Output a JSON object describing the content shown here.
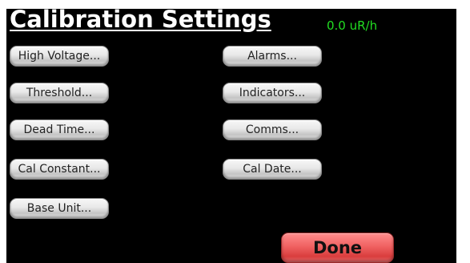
{
  "title": "Calibration Settings",
  "reading": "0.0 uR/h",
  "colors": {
    "background": "#000000",
    "reading": "#22dd22",
    "done": "#e85050"
  },
  "left_buttons": [
    {
      "label": "High Voltage..."
    },
    {
      "label": "Threshold..."
    },
    {
      "label": "Dead Time..."
    },
    {
      "label": "Cal Constant..."
    },
    {
      "label": "Base Unit..."
    }
  ],
  "right_buttons": [
    {
      "label": "Alarms..."
    },
    {
      "label": "Indicators..."
    },
    {
      "label": "Comms..."
    },
    {
      "label": "Cal Date..."
    }
  ],
  "done_label": "Done"
}
